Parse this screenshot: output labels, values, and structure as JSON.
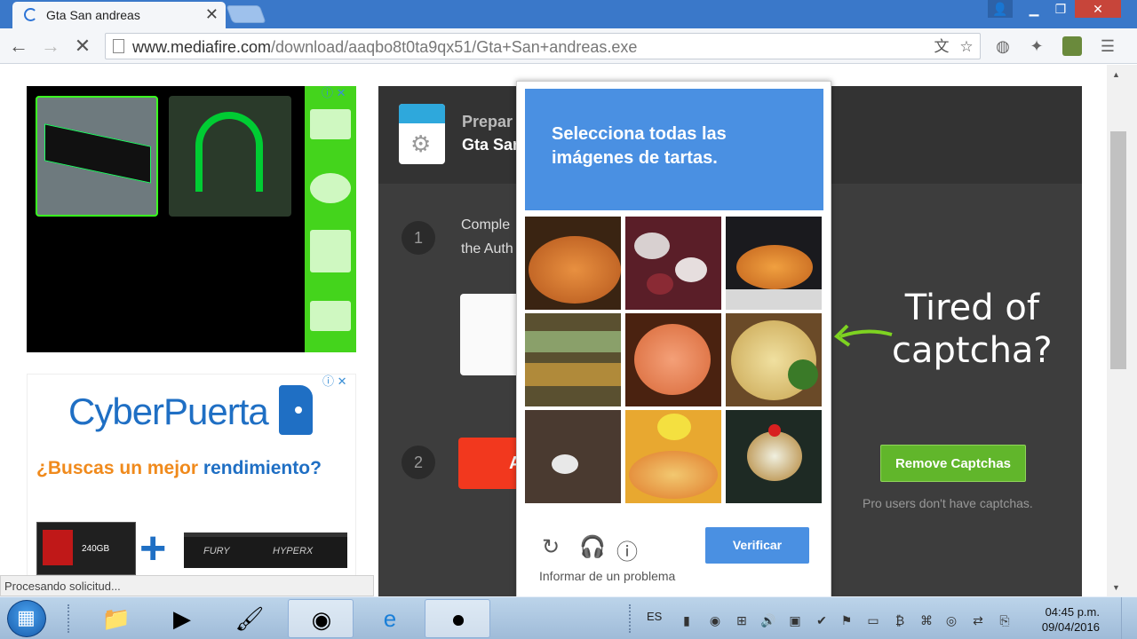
{
  "browser": {
    "tab_title": "Gta San andreas",
    "url_host": "www.mediafire.com",
    "url_path": "/download/aaqbo8t0ta9qx51/Gta+San+andreas.exe",
    "status_text": "Procesando solicitud..."
  },
  "ads": {
    "cyberpuerta": {
      "brand": "CyberPuerta",
      "slogan_part1": "¿Buscas un mejor",
      "slogan_part2": "rendimiento?",
      "ssd_label": "240GB",
      "ram_label1": "FURY",
      "ram_label2": "HYPERX"
    }
  },
  "mediafire": {
    "preparing_label": "Prepar",
    "file_name_partial": "Gta San",
    "step1_number": "1",
    "step1_line1": "Comple",
    "step1_line2": "the Auth",
    "step2_number": "2",
    "step2_button_partial": "A",
    "tired_line1": "Tired of",
    "tired_line2": "captcha?",
    "remove_button": "Remove Captchas",
    "pro_note": "Pro users don't have captchas."
  },
  "captcha": {
    "prompt_line1": "Selecciona todas las",
    "prompt_line2_a": "imágenes de",
    "prompt_line2_b": "tartas.",
    "verify_button": "Verificar",
    "report_link": "Informar de un problema",
    "header_color": "#4a90e2"
  },
  "taskbar": {
    "language": "ES",
    "time": "04:45 p.m.",
    "date": "09/04/2016"
  }
}
